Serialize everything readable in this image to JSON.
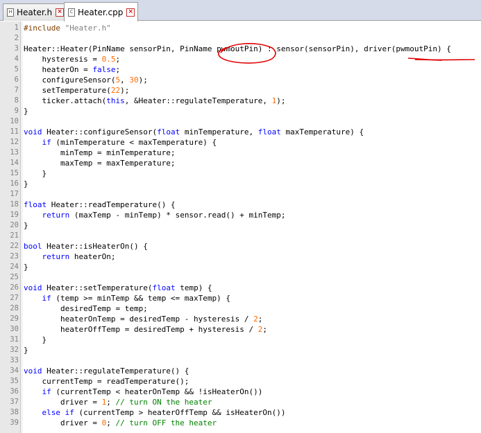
{
  "tabs": [
    {
      "label": "Heater.h",
      "icon": "file-h-icon",
      "active": false
    },
    {
      "label": "Heater.cpp",
      "icon": "file-cpp-icon",
      "active": true
    }
  ],
  "colors": {
    "keyword": "#0000ff",
    "string": "#808080",
    "number": "#ff6a00",
    "preprocessor": "#804000",
    "comment": "#008000",
    "annotation": "#e00000"
  },
  "lines": [
    {
      "n": "1",
      "t": [
        [
          "pp",
          "#include "
        ],
        [
          "str",
          "\"Heater.h\""
        ]
      ]
    },
    {
      "n": "2",
      "t": []
    },
    {
      "n": "3",
      "t": [
        [
          "",
          "Heater::Heater(PinName sensorPin, PinName pwmoutPin) : sensor(sensorPin), driver(pwmoutPin) {"
        ]
      ]
    },
    {
      "n": "4",
      "t": [
        [
          "",
          "    hysteresis = "
        ],
        [
          "num",
          "0.5"
        ],
        [
          "",
          ";"
        ]
      ]
    },
    {
      "n": "5",
      "t": [
        [
          "",
          "    heaterOn = "
        ],
        [
          "kw",
          "false"
        ],
        [
          "",
          ";"
        ]
      ]
    },
    {
      "n": "6",
      "t": [
        [
          "",
          "    configureSensor("
        ],
        [
          "num",
          "5"
        ],
        [
          "",
          ", "
        ],
        [
          "num",
          "30"
        ],
        [
          "",
          ");"
        ]
      ]
    },
    {
      "n": "7",
      "t": [
        [
          "",
          "    setTemperature("
        ],
        [
          "num",
          "22"
        ],
        [
          "",
          ");"
        ]
      ]
    },
    {
      "n": "8",
      "t": [
        [
          "",
          "    ticker.attach("
        ],
        [
          "kw",
          "this"
        ],
        [
          "",
          ", &Heater::regulateTemperature, "
        ],
        [
          "num",
          "1"
        ],
        [
          "",
          ");"
        ]
      ]
    },
    {
      "n": "9",
      "t": [
        [
          "",
          "}"
        ]
      ]
    },
    {
      "n": "10",
      "t": []
    },
    {
      "n": "11",
      "t": [
        [
          "kw",
          "void"
        ],
        [
          "",
          " Heater::configureSensor("
        ],
        [
          "kw",
          "float"
        ],
        [
          "",
          " minTemperature, "
        ],
        [
          "kw",
          "float"
        ],
        [
          "",
          " maxTemperature) {"
        ]
      ]
    },
    {
      "n": "12",
      "t": [
        [
          "",
          "    "
        ],
        [
          "kw",
          "if"
        ],
        [
          "",
          " (minTemperature < maxTemperature) {"
        ]
      ]
    },
    {
      "n": "13",
      "t": [
        [
          "",
          "        minTemp = minTemperature;"
        ]
      ]
    },
    {
      "n": "14",
      "t": [
        [
          "",
          "        maxTemp = maxTemperature;"
        ]
      ]
    },
    {
      "n": "15",
      "t": [
        [
          "",
          "    }"
        ]
      ]
    },
    {
      "n": "16",
      "t": [
        [
          "",
          "}"
        ]
      ]
    },
    {
      "n": "17",
      "t": []
    },
    {
      "n": "18",
      "t": [
        [
          "kw",
          "float"
        ],
        [
          "",
          " Heater::readTemperature() {"
        ]
      ]
    },
    {
      "n": "19",
      "t": [
        [
          "",
          "    "
        ],
        [
          "kw",
          "return"
        ],
        [
          "",
          " (maxTemp - minTemp) * sensor.read() + minTemp;"
        ]
      ]
    },
    {
      "n": "20",
      "t": [
        [
          "",
          "}"
        ]
      ]
    },
    {
      "n": "21",
      "t": []
    },
    {
      "n": "22",
      "t": [
        [
          "kw",
          "bool"
        ],
        [
          "",
          " Heater::isHeaterOn() {"
        ]
      ]
    },
    {
      "n": "23",
      "t": [
        [
          "",
          "    "
        ],
        [
          "kw",
          "return"
        ],
        [
          "",
          " heaterOn;"
        ]
      ]
    },
    {
      "n": "24",
      "t": [
        [
          "",
          "}"
        ]
      ]
    },
    {
      "n": "25",
      "t": []
    },
    {
      "n": "26",
      "t": [
        [
          "kw",
          "void"
        ],
        [
          "",
          " Heater::setTemperature("
        ],
        [
          "kw",
          "float"
        ],
        [
          "",
          " temp) {"
        ]
      ]
    },
    {
      "n": "27",
      "t": [
        [
          "",
          "    "
        ],
        [
          "kw",
          "if"
        ],
        [
          "",
          " (temp >= minTemp && temp <= maxTemp) {"
        ]
      ]
    },
    {
      "n": "28",
      "t": [
        [
          "",
          "        desiredTemp = temp;"
        ]
      ]
    },
    {
      "n": "29",
      "t": [
        [
          "",
          "        heaterOnTemp = desiredTemp - hysteresis / "
        ],
        [
          "num",
          "2"
        ],
        [
          "",
          ";"
        ]
      ]
    },
    {
      "n": "30",
      "t": [
        [
          "",
          "        heaterOffTemp = desiredTemp + hysteresis / "
        ],
        [
          "num",
          "2"
        ],
        [
          "",
          ";"
        ]
      ]
    },
    {
      "n": "31",
      "t": [
        [
          "",
          "    }"
        ]
      ]
    },
    {
      "n": "32",
      "t": [
        [
          "",
          "}"
        ]
      ]
    },
    {
      "n": "33",
      "t": []
    },
    {
      "n": "34",
      "t": [
        [
          "kw",
          "void"
        ],
        [
          "",
          " Heater::regulateTemperature() {"
        ]
      ]
    },
    {
      "n": "35",
      "t": [
        [
          "",
          "    currentTemp = readTemperature();"
        ]
      ]
    },
    {
      "n": "36",
      "t": [
        [
          "",
          "    "
        ],
        [
          "kw",
          "if"
        ],
        [
          "",
          " (currentTemp < heaterOnTemp && !isHeaterOn())"
        ]
      ]
    },
    {
      "n": "37",
      "t": [
        [
          "",
          "        driver = "
        ],
        [
          "num",
          "1"
        ],
        [
          "",
          "; "
        ],
        [
          "cmt",
          "// turn ON the heater"
        ]
      ]
    },
    {
      "n": "38",
      "t": [
        [
          "",
          "    "
        ],
        [
          "kw",
          "else if"
        ],
        [
          "",
          " (currentTemp > heaterOffTemp && isHeaterOn())"
        ]
      ]
    },
    {
      "n": "39",
      "t": [
        [
          "",
          "        driver = "
        ],
        [
          "num",
          "0"
        ],
        [
          "",
          "; "
        ],
        [
          "cmt",
          "// turn OFF the heater"
        ]
      ]
    }
  ]
}
